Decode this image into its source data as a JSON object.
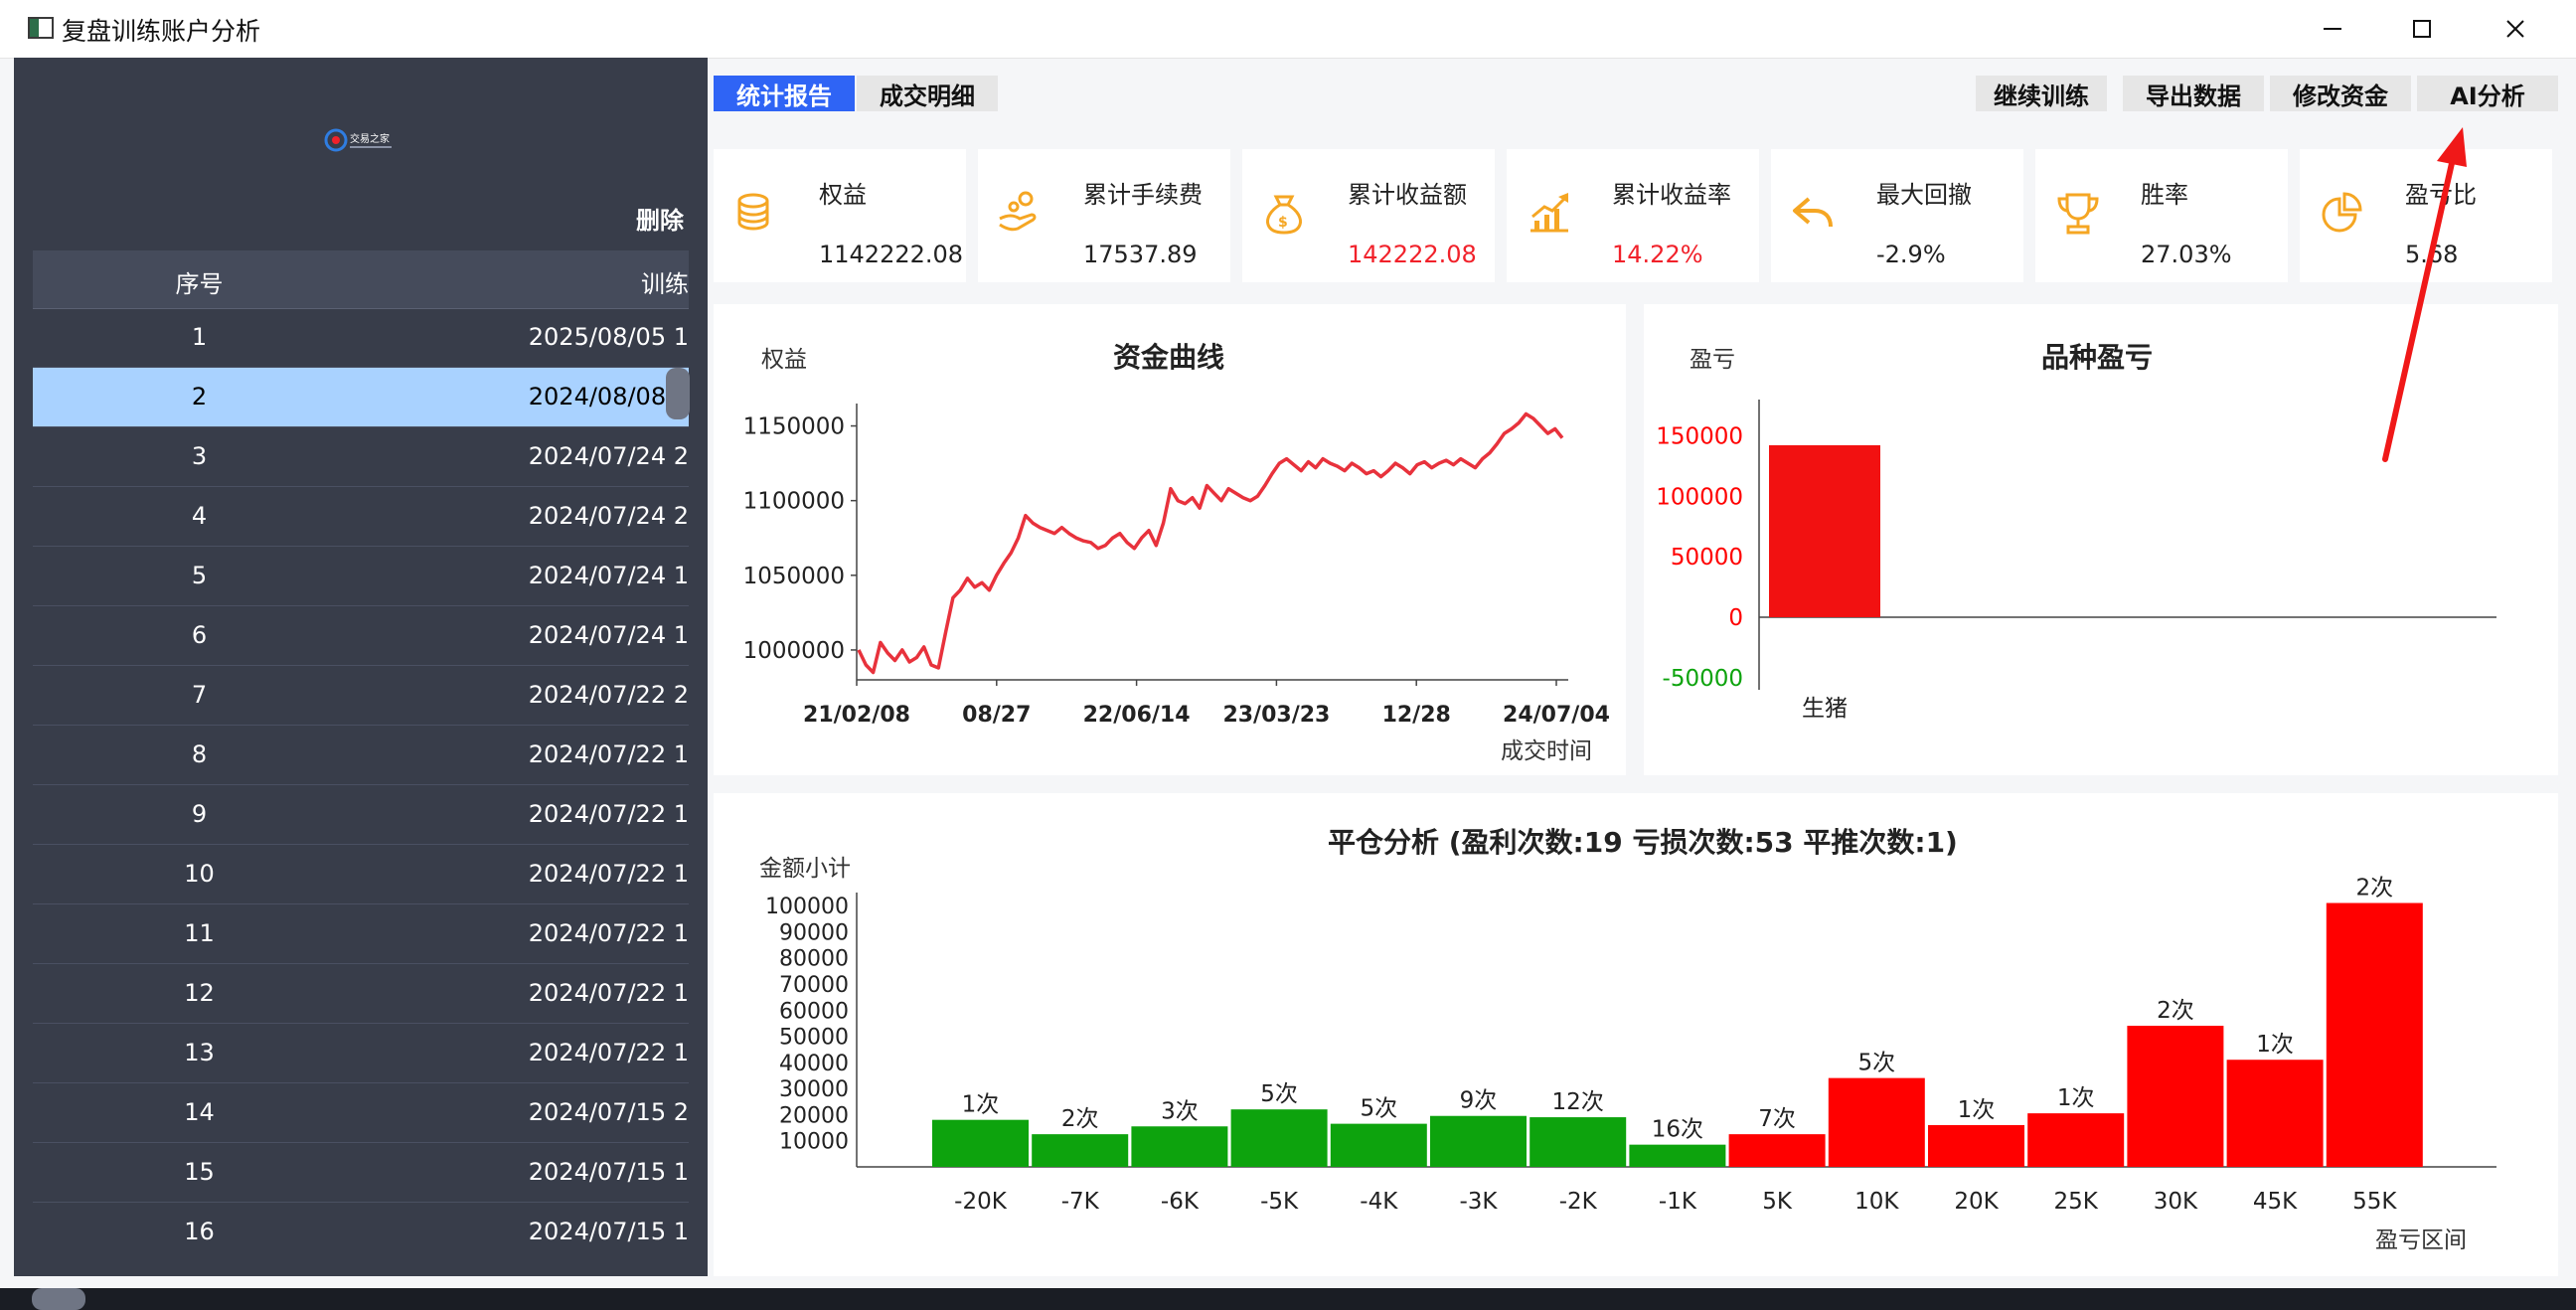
{
  "window": {
    "title": "复盘训练账户分析",
    "controls": {
      "minimize": "minimize",
      "maximize": "maximize",
      "close": "close"
    }
  },
  "sidebar": {
    "logo_text": "交易之家",
    "delete_label": "删除",
    "columns": {
      "index": "序号",
      "date": "训练"
    },
    "rows": [
      {
        "idx": "1",
        "date": "2025/08/05 1"
      },
      {
        "idx": "2",
        "date": "2024/08/08 2",
        "selected": true
      },
      {
        "idx": "3",
        "date": "2024/07/24 2"
      },
      {
        "idx": "4",
        "date": "2024/07/24 2"
      },
      {
        "idx": "5",
        "date": "2024/07/24 1"
      },
      {
        "idx": "6",
        "date": "2024/07/24 1"
      },
      {
        "idx": "7",
        "date": "2024/07/22 2"
      },
      {
        "idx": "8",
        "date": "2024/07/22 1"
      },
      {
        "idx": "9",
        "date": "2024/07/22 1"
      },
      {
        "idx": "10",
        "date": "2024/07/22 1"
      },
      {
        "idx": "11",
        "date": "2024/07/22 1"
      },
      {
        "idx": "12",
        "date": "2024/07/22 1"
      },
      {
        "idx": "13",
        "date": "2024/07/22 1"
      },
      {
        "idx": "14",
        "date": "2024/07/15 2"
      },
      {
        "idx": "15",
        "date": "2024/07/15 1"
      },
      {
        "idx": "16",
        "date": "2024/07/15 1"
      }
    ]
  },
  "tabs": {
    "stats": "统计报告",
    "trades": "成交明细"
  },
  "actions": {
    "continue": "继续训练",
    "export": "导出数据",
    "modify": "修改资金",
    "ai": "AI分析"
  },
  "cards": [
    {
      "label": "权益",
      "value": "1142222.08",
      "icon": "coins-icon"
    },
    {
      "label": "累计手续费",
      "value": "17537.89",
      "icon": "hand-coin-icon"
    },
    {
      "label": "累计收益额",
      "value": "142222.08",
      "icon": "money-bag-icon",
      "highlight": true
    },
    {
      "label": "累计收益率",
      "value": "14.22%",
      "icon": "growth-chart-icon",
      "highlight": true
    },
    {
      "label": "最大回撤",
      "value": "-2.9%",
      "icon": "undo-arrow-icon"
    },
    {
      "label": "胜率",
      "value": "27.03%",
      "icon": "trophy-icon"
    },
    {
      "label": "盈亏比",
      "value": "5.68",
      "icon": "pie-icon"
    }
  ],
  "colors": {
    "accent": "#2f64f5",
    "icon_orange": "#f5a623",
    "profit_red": "#ff0000",
    "loss_green": "#0da30d",
    "line_red": "#e8323c"
  },
  "chart_data": [
    {
      "type": "line",
      "title": "资金曲线",
      "ylabel": "权益",
      "xlabel": "成交时间",
      "ylim": [
        980000,
        1165000
      ],
      "yticks": [
        "1000000",
        "1050000",
        "1100000",
        "1150000"
      ],
      "xticks": [
        "21/02/08",
        "08/27",
        "22/06/14",
        "23/03/23",
        "12/28",
        "24/07/04"
      ],
      "series": [
        {
          "values": [
            1000000,
            990000,
            985000,
            1005000,
            998000,
            993000,
            1000000,
            992000,
            995000,
            1002000,
            990000,
            988000,
            1012000,
            1035000,
            1040000,
            1048000,
            1042000,
            1045000,
            1040000,
            1050000,
            1058000,
            1065000,
            1075000,
            1090000,
            1085000,
            1082000,
            1080000,
            1078000,
            1082000,
            1078000,
            1075000,
            1073000,
            1072000,
            1068000,
            1070000,
            1075000,
            1078000,
            1072000,
            1068000,
            1075000,
            1080000,
            1070000,
            1085000,
            1108000,
            1100000,
            1098000,
            1102000,
            1095000,
            1110000,
            1105000,
            1100000,
            1108000,
            1105000,
            1102000,
            1100000,
            1103000,
            1110000,
            1118000,
            1125000,
            1128000,
            1124000,
            1120000,
            1126000,
            1122000,
            1128000,
            1125000,
            1123000,
            1120000,
            1125000,
            1122000,
            1118000,
            1120000,
            1116000,
            1120000,
            1125000,
            1122000,
            1118000,
            1124000,
            1126000,
            1122000,
            1125000,
            1127000,
            1124000,
            1128000,
            1125000,
            1122000,
            1128000,
            1132000,
            1138000,
            1145000,
            1148000,
            1152000,
            1158000,
            1155000,
            1150000,
            1145000,
            1148000,
            1142000
          ]
        }
      ]
    },
    {
      "type": "bar",
      "title": "品种盈亏",
      "ylabel": "盈亏",
      "categories": [
        "生猪"
      ],
      "values": [
        142222.08
      ],
      "ylim": [
        -60000,
        180000
      ],
      "yticks": [
        "-50000",
        "0",
        "50000",
        "100000",
        "150000"
      ]
    },
    {
      "type": "bar",
      "title": "平仓分析 (盈利次数:19 亏损次数:53 平推次数:1)",
      "ylabel": "金额小计",
      "xlabel": "盈亏区间",
      "ylim": [
        0,
        105000
      ],
      "yticks": [
        "10000",
        "20000",
        "30000",
        "40000",
        "50000",
        "60000",
        "70000",
        "80000",
        "90000",
        "100000"
      ],
      "categories": [
        "-20K",
        "-7K",
        "-6K",
        "-5K",
        "-4K",
        "-3K",
        "-2K",
        "-1K",
        "5K",
        "10K",
        "20K",
        "25K",
        "30K",
        "45K",
        "55K"
      ],
      "values": [
        18000,
        12500,
        15500,
        22000,
        16500,
        19500,
        19000,
        8500,
        12500,
        34000,
        16000,
        20500,
        54000,
        41000,
        101000
      ],
      "labels": [
        "1次",
        "2次",
        "3次",
        "5次",
        "5次",
        "9次",
        "12次",
        "16次",
        "7次",
        "5次",
        "1次",
        "1次",
        "2次",
        "1次",
        "2次"
      ],
      "colors": [
        "green",
        "green",
        "green",
        "green",
        "green",
        "green",
        "green",
        "green",
        "red",
        "red",
        "red",
        "red",
        "red",
        "red",
        "red"
      ]
    }
  ]
}
